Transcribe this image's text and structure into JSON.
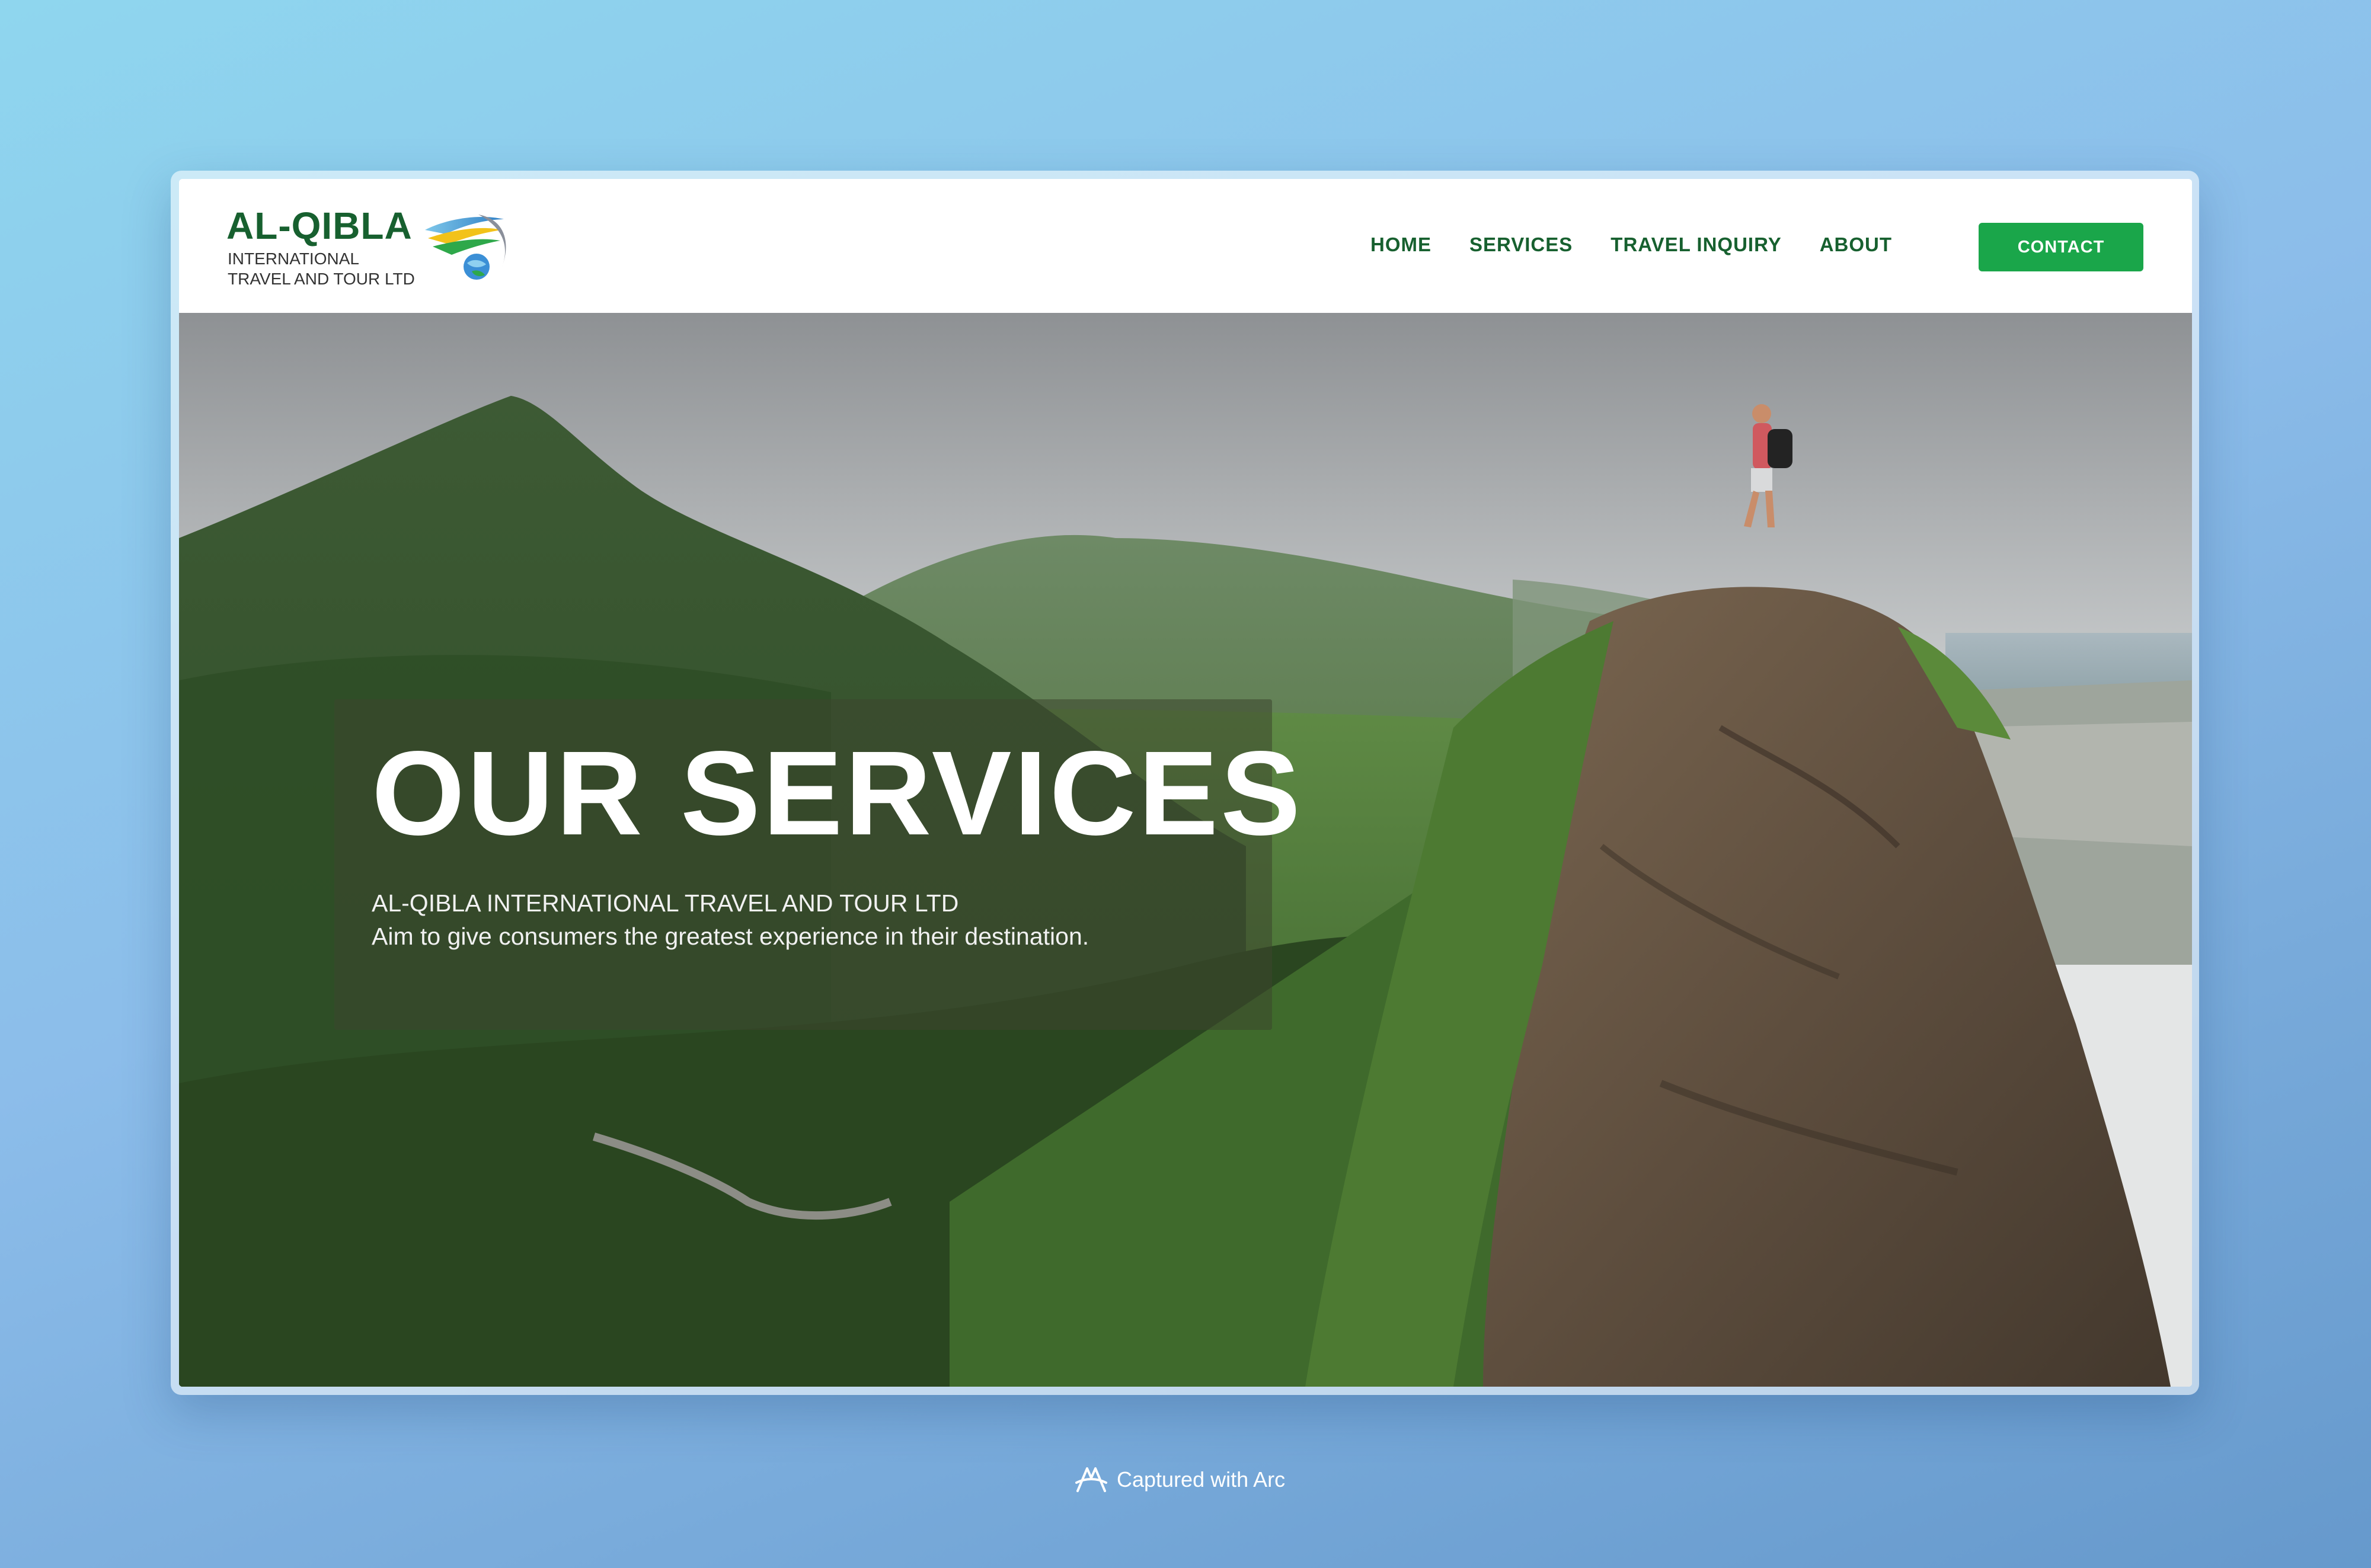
{
  "brand": {
    "title": "AL-QIBLA",
    "subtitle_line1": "INTERNATIONAL",
    "subtitle_line2": "TRAVEL AND TOUR LTD",
    "logo_icon": "globe-swoosh-logo"
  },
  "nav": {
    "items": [
      {
        "label": "HOME"
      },
      {
        "label": "SERVICES"
      },
      {
        "label": "TRAVEL INQUIRY"
      },
      {
        "label": "ABOUT"
      }
    ],
    "contact_label": "CONTACT"
  },
  "hero": {
    "title": "OUR SERVICES",
    "line1": "AL-QIBLA INTERNATIONAL TRAVEL AND TOUR LTD",
    "line2": "Aim to give consumers the greatest experience in their destination.",
    "image": "hiker-on-mountain-peak-photo"
  },
  "footer": {
    "caption": "Captured with Arc",
    "icon": "arc-logo-icon"
  },
  "colors": {
    "brand_green": "#17602f",
    "button_green": "#1aa64a",
    "background_gradient_start": "#8fd6ee",
    "background_gradient_end": "#6699cc"
  }
}
